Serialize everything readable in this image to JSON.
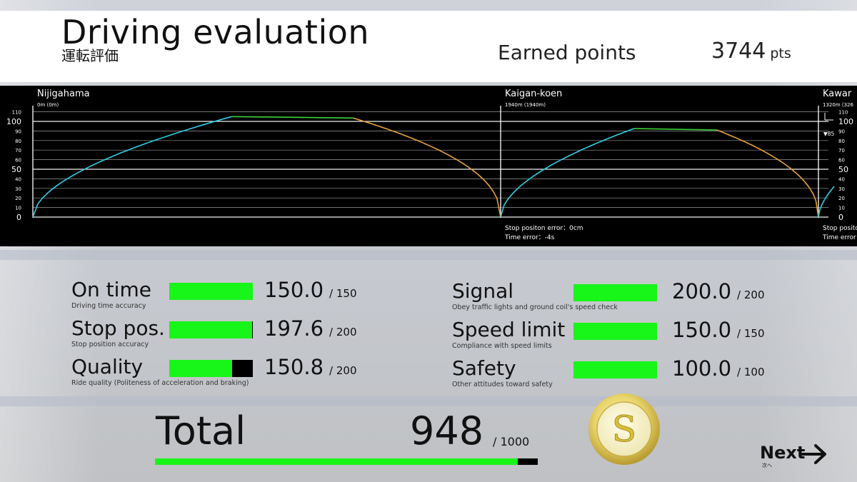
{
  "header": {
    "title": "Driving evaluation",
    "subtitle": "運転評価",
    "earned_label": "Earned points",
    "earned_value": "3744",
    "earned_unit": "pts"
  },
  "chart_data": {
    "type": "line",
    "title": "",
    "xlabel": "",
    "ylabel": "",
    "ylim": [
      0,
      110
    ],
    "y_ticks": [
      0,
      10,
      20,
      30,
      40,
      50,
      60,
      70,
      80,
      90,
      100,
      110
    ],
    "major_ticks": [
      0,
      50,
      100
    ],
    "grid": true,
    "stations": [
      {
        "name": "Nijigahama",
        "dist": "0m (0m)"
      },
      {
        "name": "Kaigan-koen",
        "dist": "1940m (1940m)",
        "info": [
          "Stop positon error：0cm",
          "Time error：-4s"
        ]
      },
      {
        "name": "Kawar",
        "dist": "1320m (326",
        "info": [
          "Stop positon error",
          "Time error"
        ]
      }
    ],
    "speed_limit_marker": "▼85",
    "series": [
      {
        "segment": "Nijigahama–Kaigan-koen",
        "colors": {
          "accelerate": "#2ed0e6",
          "coast": "#3ad43a",
          "brake": "#e8a23a"
        },
        "profile_fraction_speed": [
          [
            0.0,
            0
          ],
          [
            0.01,
            10
          ],
          [
            0.03,
            22
          ],
          [
            0.06,
            34
          ],
          [
            0.1,
            46
          ],
          [
            0.15,
            57
          ],
          [
            0.2,
            66
          ],
          [
            0.26,
            75
          ],
          [
            0.32,
            83
          ],
          [
            0.38,
            90
          ],
          [
            0.45,
            97
          ],
          [
            0.52,
            102
          ],
          [
            0.57,
            105
          ],
          [
            0.68,
            104.5
          ],
          [
            0.81,
            104
          ],
          [
            0.84,
            101
          ],
          [
            0.88,
            94
          ],
          [
            0.92,
            85
          ],
          [
            0.95,
            77
          ],
          [
            0.975,
            69
          ],
          [
            1.0,
            61.7
          ]
        ]
      }
    ]
  },
  "scores": [
    {
      "label": "On time",
      "sub": "Driving time accuracy",
      "value": "150.0",
      "max": "/ 150",
      "fraction": 1.0
    },
    {
      "label": "Stop pos.",
      "sub": "Stop position accuracy",
      "value": "197.6",
      "max": "/ 200",
      "fraction": 0.988
    },
    {
      "label": "Quality",
      "sub": "Ride quality (Politeness of acceleration and braking)",
      "value": "150.8",
      "max": "/ 200",
      "fraction": 0.754
    },
    {
      "label": "Signal",
      "sub": "Obey traffic lights and ground coil's speed check",
      "value": "200.0",
      "max": "/ 200",
      "fraction": 1.0
    },
    {
      "label": "Speed limit",
      "sub": "Compliance with speed limits",
      "value": "150.0",
      "max": "/ 150",
      "fraction": 1.0
    },
    {
      "label": "Safety",
      "sub": "Other attitudes toward safety",
      "value": "100.0",
      "max": "/ 100",
      "fraction": 1.0
    }
  ],
  "total": {
    "label": "Total",
    "value": "948",
    "max": "/ 1000",
    "fraction": 0.948
  },
  "rank": {
    "letter": "S",
    "icon": "rank-s-medal-icon",
    "color_gold": "#e8d870"
  },
  "next": {
    "label": "Next",
    "sub": "次へ",
    "icon": "arrow-right-icon"
  },
  "colors": {
    "bar_fill": "#18f518",
    "bar_empty": "#000000"
  }
}
